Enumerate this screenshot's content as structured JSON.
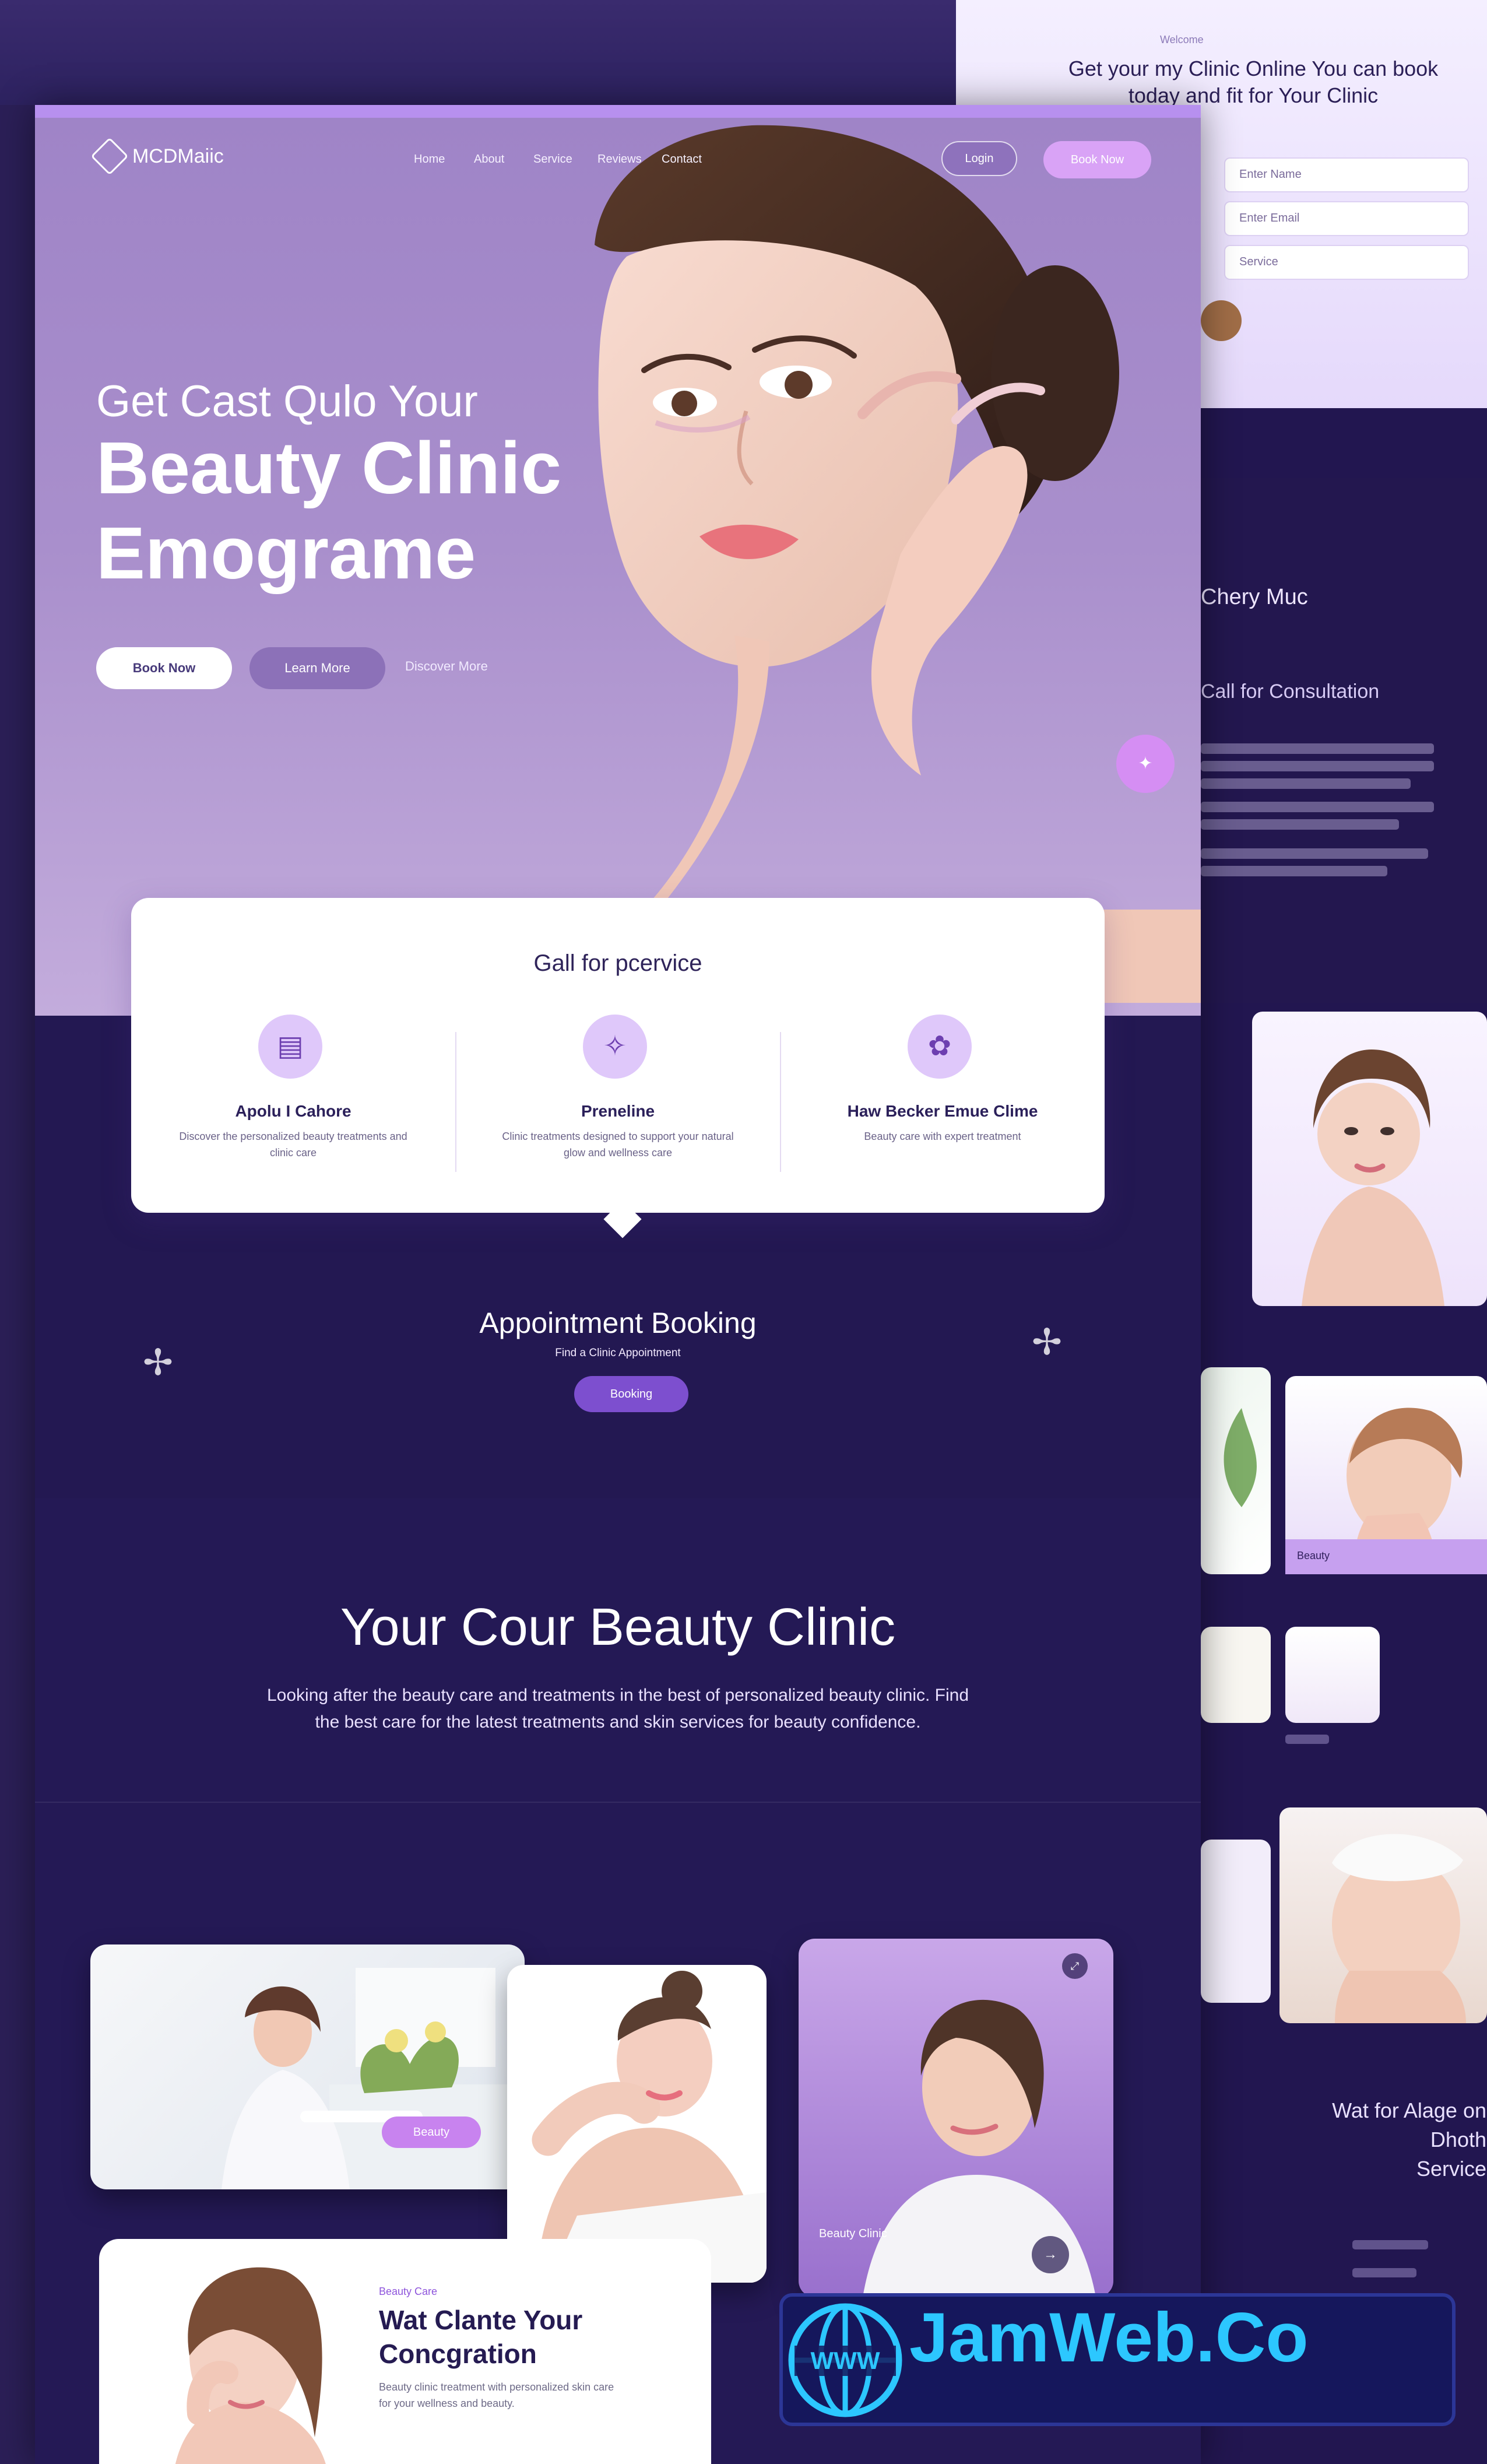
{
  "brand": {
    "logo_text": "MCDMaiic",
    "nav": [
      "Home",
      "About",
      "Service",
      "Reviews",
      "Contact"
    ],
    "login_button": "Login",
    "cta_button": "Book Now"
  },
  "hero": {
    "kicker": "Get Cast Qulo Your",
    "title_line_1": "Beauty Clinic",
    "title_line_2": "Emograme",
    "primary_button": "Book Now",
    "secondary_button": "Learn More",
    "tertiary_link": "Discover More"
  },
  "services": {
    "heading": "Gall for pcervice",
    "items": [
      {
        "icon": "product-box-icon",
        "name": "Apolu I Cahore",
        "description": "Discover the personalized beauty treatments and clinic care"
      },
      {
        "icon": "medical-sparkle-icon",
        "name": "Preneline",
        "description": "Clinic treatments designed to support your natural glow and wellness care"
      },
      {
        "icon": "skin-care-icon",
        "name": "Haw Becker Emue Clime",
        "description": "Beauty care with expert treatment"
      }
    ]
  },
  "booking": {
    "title": "Appointment Booking",
    "subtitle": "Find a Clinic Appointment",
    "button": "Booking"
  },
  "about": {
    "title": "Your Cour Beauty Clinic",
    "text": "Looking after the beauty care and treatments in the best of personalized beauty clinic. Find the best care for the latest treatments and skin services for beauty confidence."
  },
  "gallery": {
    "tag": "Beauty",
    "caption": "Beauty Clinic"
  },
  "feature": {
    "eyebrow": "Beauty Care",
    "title_line_1": "Wat Clante Your",
    "title_line_2": "Concgration",
    "text": "Beauty clinic treatment with personalized skin care for your wellness and beauty."
  },
  "side_page": {
    "small_label": "Welcome",
    "title": "Get your my Clinic Online You can book today and fit for Your Clinic",
    "fields": [
      "Enter Name",
      "Enter Email",
      "Service"
    ],
    "about_title": "Chery Muc",
    "about_sub": "Call for Consultation",
    "mini_caption": "Beauty",
    "footer_line_1": "Wat for Alage on Dhoth",
    "footer_line_2": "Service"
  },
  "watermark": {
    "text": "JamWeb.Co",
    "globe_label": "WWW"
  },
  "colors": {
    "primary": "#7d4fcf",
    "lavender": "#c3acdc",
    "accent": "#d58ef3",
    "dark": "#241955",
    "watermark_blue": "#2cc7ff"
  }
}
